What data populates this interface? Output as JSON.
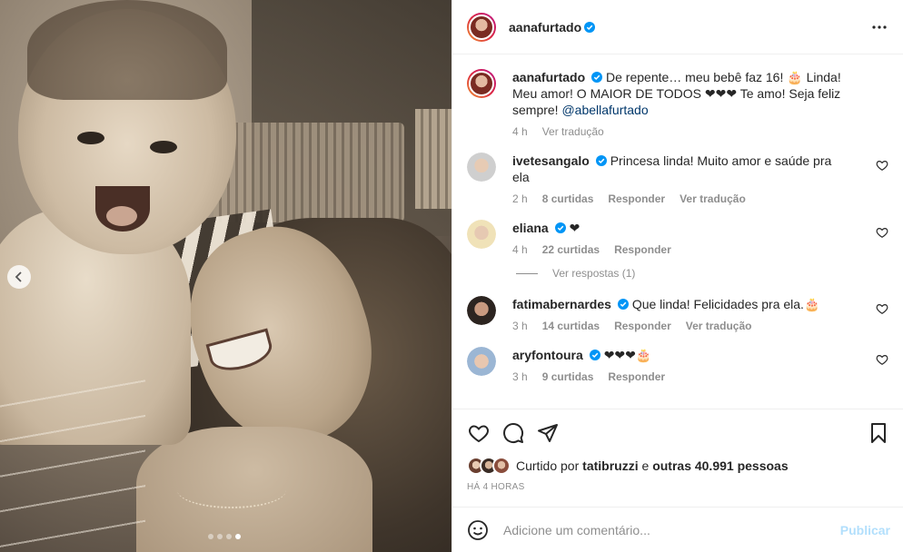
{
  "post": {
    "author": "aanafurtado",
    "carousel": {
      "slides": 4,
      "active_index": 3
    }
  },
  "caption": {
    "username": "aanafurtado",
    "text": "De repente… meu bebê faz 16! 🎂 Linda! Meu amor! O MAIOR DE TODOS ❤❤❤ Te amo! Seja feliz sempre!",
    "mention": "@abellafurtado",
    "time": "4 h",
    "translate": "Ver tradução"
  },
  "comments": [
    {
      "username": "ivetesangalo",
      "verified": true,
      "text": "Princesa linda! Muito amor e saúde pra ela",
      "time": "2 h",
      "likes": "8 curtidas",
      "reply": "Responder",
      "translate": "Ver tradução"
    },
    {
      "username": "eliana",
      "verified": true,
      "text": "❤",
      "time": "4 h",
      "likes": "22 curtidas",
      "reply": "Responder",
      "view_replies": "Ver respostas (1)"
    },
    {
      "username": "fatimabernardes",
      "verified": true,
      "text": "Que linda! Felicidades pra ela.🎂",
      "time": "3 h",
      "likes": "14 curtidas",
      "reply": "Responder",
      "translate": "Ver tradução"
    },
    {
      "username": "aryfontoura",
      "verified": true,
      "text": "❤❤❤🎂",
      "time": "3 h",
      "likes": "9 curtidas",
      "reply": "Responder"
    }
  ],
  "likes": {
    "prefix": "Curtido por",
    "first_user": "tatibruzzi",
    "connector": "e",
    "others": "outras 40.991 pessoas"
  },
  "timestamp": "HÁ 4 HORAS",
  "add_comment": {
    "placeholder": "Adicione um comentário...",
    "publish": "Publicar"
  },
  "colors": {
    "verified": "#0095f6",
    "text": "#262626",
    "muted": "#8e8e8e",
    "publish_disabled": "#b2dffc"
  }
}
